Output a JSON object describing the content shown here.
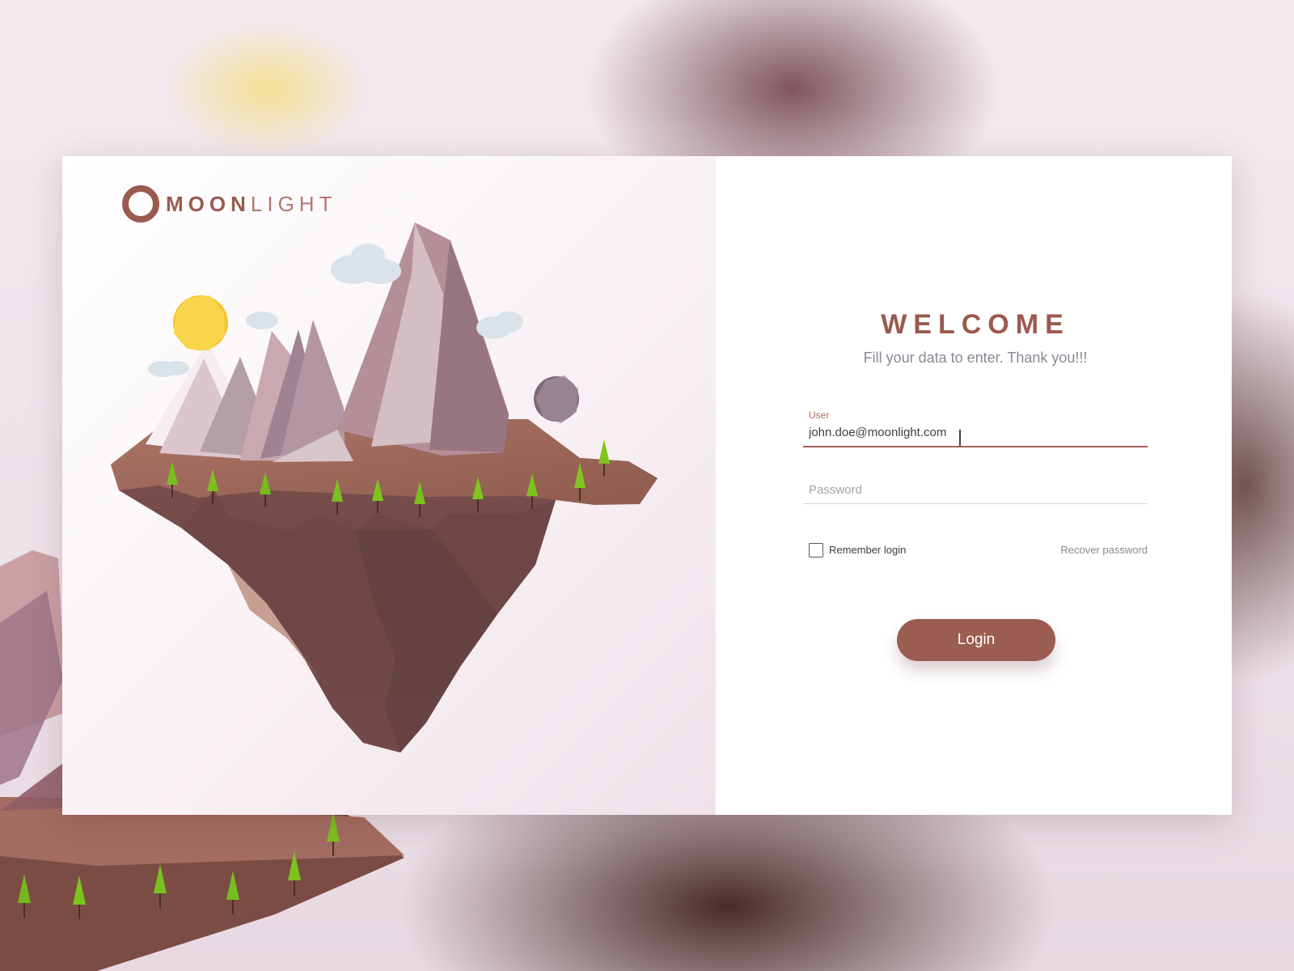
{
  "brand": {
    "strong": "MOON",
    "light": "LIGHT"
  },
  "login": {
    "title": "WELCOME",
    "subtitle": "Fill your data to enter. Thank you!!!",
    "user_label": "User",
    "user_value": "john.doe@moonlight.com",
    "password_placeholder": "Password",
    "remember_label": "Remember login",
    "remember_checked": false,
    "recover_label": "Recover password",
    "button_label": "Login"
  },
  "colors": {
    "accent": "#9b5c52",
    "accent_light": "#b3695f",
    "text_muted": "#8e8594",
    "input_text": "#3f3d44",
    "background": "#f3eaef",
    "card_left": "#f8f1f5",
    "card_right": "#ffffff"
  },
  "icons": {
    "logo": "moon-logo-icon",
    "checkbox": "checkbox-icon"
  }
}
